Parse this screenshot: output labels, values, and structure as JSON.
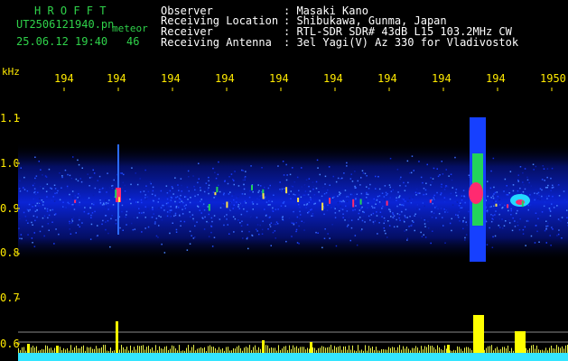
{
  "app": {
    "title": "H R O F F T"
  },
  "file": {
    "name": "UT2506121940.pn",
    "type": "meteor",
    "date_time": "25.06.12 19:40",
    "count": "46"
  },
  "header": {
    "rows": [
      {
        "label": "Observer",
        "value": ": Masaki Kano"
      },
      {
        "label": "Receiving Location",
        "value": ": Shibukawa, Gunma, Japan"
      },
      {
        "label": "Receiver",
        "value": ": RTL-SDR SDR# 43dB L15 103.2MHz CW"
      },
      {
        "label": "Receiving Antenna",
        "value": ": 3el Yagi(V) Az 330 for Vladivostok"
      }
    ]
  },
  "axis": {
    "unit": "kHz",
    "time_ticks": [
      "194",
      "194",
      "194",
      "194",
      "194",
      "194",
      "194",
      "194",
      "194",
      "1950"
    ],
    "freq_ticks": [
      "1.1",
      "1.0",
      "0.9",
      "0.8",
      "0.7",
      "0.6"
    ]
  },
  "colors": {
    "title": "#2fd24a",
    "axis_text": "#ffea00",
    "plot": "#0018c8",
    "signal": "#ff2a70",
    "intensity": "#33e5ff"
  }
}
